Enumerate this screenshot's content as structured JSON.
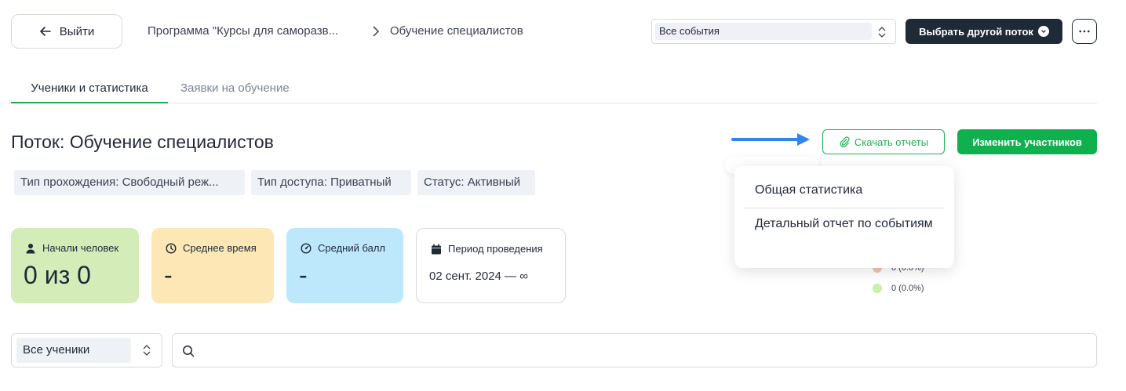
{
  "header": {
    "back_label": "Выйти",
    "breadcrumb_program": "Программа \"Курсы для саморазв...",
    "breadcrumb_stream": "Обучение специалистов",
    "events_select_value": "Все события",
    "choose_stream_label": "Выбрать другой поток"
  },
  "tabs": [
    {
      "label": "Ученики и статистика",
      "active": true
    },
    {
      "label": "Заявки на обучение",
      "active": false
    }
  ],
  "page": {
    "title": "Поток: Обучение специалистов",
    "download_label": "Скачать отчеты",
    "change_participants_label": "Изменить участников"
  },
  "chips": [
    "Тип прохождения: Свободный реж...",
    "Тип доступа: Приватный",
    "Статус: Активный"
  ],
  "dropdown": {
    "items": [
      "Общая статистика",
      "Детальный отчет по событиям"
    ]
  },
  "cards": [
    {
      "label": "Начали человек",
      "value": "0 из 0",
      "color": "#d3ecb8",
      "icon": "user-icon"
    },
    {
      "label": "Среднее время",
      "value": "-",
      "color": "#fde7b5",
      "icon": "clock-icon"
    },
    {
      "label": "Средний балл",
      "value": "-",
      "color": "#bde8fc",
      "icon": "speedometer-icon"
    },
    {
      "label": "Период проведения",
      "value": "02 сент. 2024 — ∞",
      "color": "#ffffff",
      "icon": "calendar-icon"
    }
  ],
  "legend": [
    {
      "text": "0 (0.0%)",
      "color": "#f6c5ad"
    },
    {
      "text": "0 (0.0%)",
      "color": "#c9efa8"
    }
  ],
  "filters": {
    "students_select_value": "Все ученики",
    "search_placeholder": ""
  },
  "colors": {
    "accent_green": "#0fb14f",
    "dark_button": "#1f2a37",
    "arrow_blue": "#2f86eb"
  }
}
